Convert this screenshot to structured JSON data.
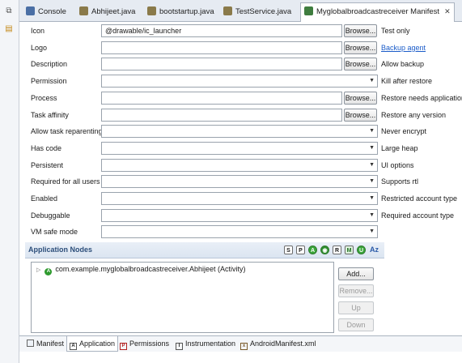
{
  "leftbar": {
    "icons": [
      "restore-icon",
      "package-explorer-icon"
    ]
  },
  "tabs": [
    {
      "label": "Console",
      "icon": "console-icon",
      "color": "#4a6fa5",
      "active": false
    },
    {
      "label": "Abhijeet.java",
      "icon": "java-file-icon",
      "color": "#7a6a3a",
      "active": false
    },
    {
      "label": "bootstartup.java",
      "icon": "java-file-icon",
      "color": "#7a6a3a",
      "active": false
    },
    {
      "label": "TestService.java",
      "icon": "java-file-icon",
      "color": "#7a6a3a",
      "active": false
    },
    {
      "label": "Myglobalbroadcastreceiver Manifest",
      "icon": "manifest-icon",
      "color": "#3f7d3f",
      "active": true,
      "close": "✕"
    }
  ],
  "form": {
    "browse_label": "Browse...",
    "rows": [
      {
        "label": "Icon",
        "type": "text",
        "value": "@drawable/ic_launcher",
        "browse": true,
        "right": "Test only",
        "right_link": false
      },
      {
        "label": "Logo",
        "type": "text",
        "value": "",
        "browse": true,
        "right": "Backup agent",
        "right_link": true
      },
      {
        "label": "Description",
        "type": "text",
        "value": "",
        "browse": true,
        "right": "Allow backup",
        "right_link": false
      },
      {
        "label": "Permission",
        "type": "select",
        "value": "",
        "browse": false,
        "right": "Kill after restore",
        "right_link": false
      },
      {
        "label": "Process",
        "type": "text",
        "value": "",
        "browse": true,
        "right": "Restore needs application",
        "right_link": false
      },
      {
        "label": "Task affinity",
        "type": "text",
        "value": "",
        "browse": true,
        "right": "Restore any version",
        "right_link": false
      },
      {
        "label": "Allow task reparenting",
        "type": "select",
        "value": "",
        "browse": false,
        "right": "Never encrypt",
        "right_link": false
      },
      {
        "label": "Has code",
        "type": "select",
        "value": "",
        "browse": false,
        "right": "Large heap",
        "right_link": false
      },
      {
        "label": "Persistent",
        "type": "select",
        "value": "",
        "browse": false,
        "right": "UI options",
        "right_link": false
      },
      {
        "label": "Required for all users",
        "type": "select",
        "value": "",
        "browse": false,
        "right": "Supports rtl",
        "right_link": false
      },
      {
        "label": "Enabled",
        "type": "select",
        "value": "",
        "browse": false,
        "right": "Restricted account type",
        "right_link": false
      },
      {
        "label": "Debuggable",
        "type": "select",
        "value": "",
        "browse": false,
        "right": "Required account type",
        "right_link": false
      },
      {
        "label": "VM safe mode",
        "type": "select",
        "value": "",
        "browse": false,
        "right": "",
        "right_link": false
      }
    ]
  },
  "app_nodes": {
    "title": "Application Nodes",
    "toolbar": [
      {
        "glyph": "S",
        "style": "sq",
        "icon": "service-icon"
      },
      {
        "glyph": "P",
        "style": "sq",
        "icon": "provider-icon"
      },
      {
        "glyph": "A",
        "style": "circ",
        "icon": "activity-icon"
      },
      {
        "glyph": "◉",
        "style": "circ c2",
        "icon": "activity-alias-icon"
      },
      {
        "glyph": "R",
        "style": "sq",
        "icon": "receiver-icon"
      },
      {
        "glyph": "M",
        "style": "sq green",
        "icon": "metadata-icon"
      },
      {
        "glyph": "U",
        "style": "circ",
        "icon": "uses-library-icon"
      }
    ],
    "sort_label": "Az",
    "tree_items": [
      {
        "text": "com.example.myglobalbroadcastreceiver.Abhijeet (Activity)"
      }
    ],
    "buttons": [
      {
        "label": "Add...",
        "enabled": true
      },
      {
        "label": "Remove...",
        "enabled": false
      },
      {
        "label": "Up",
        "enabled": false
      },
      {
        "label": "Down",
        "enabled": false
      }
    ]
  },
  "bottom_tabs": [
    {
      "label": "Manifest",
      "glyph": "",
      "active": false
    },
    {
      "label": "Application",
      "glyph": "A",
      "active": true
    },
    {
      "label": "Permissions",
      "glyph": "P",
      "active": false
    },
    {
      "label": "Instrumentation",
      "glyph": "I",
      "active": false
    },
    {
      "label": "AndroidManifest.xml",
      "glyph": "x",
      "active": false
    }
  ]
}
